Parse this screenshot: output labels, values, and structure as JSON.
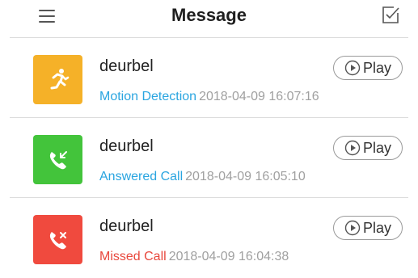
{
  "header": {
    "title": "Message",
    "menu_icon": "hamburger-menu-icon",
    "edit_icon": "select-checkbox-icon"
  },
  "messages": [
    {
      "device": "deurbel",
      "type": "Motion Detection",
      "time": "2018-04-09 16:07:16",
      "type_color": "#2aa5e0",
      "icon": "running-person-icon",
      "icon_bg": "#f5b128",
      "play_label": "Play"
    },
    {
      "device": "deurbel",
      "type": "Answered Call",
      "time": "2018-04-09 16:05:10",
      "type_color": "#2aa5e0",
      "icon": "incoming-call-icon",
      "icon_bg": "#43c43b",
      "play_label": "Play"
    },
    {
      "device": "deurbel",
      "type": "Missed Call",
      "time": "2018-04-09 16:04:38",
      "type_color": "#e8473c",
      "icon": "missed-call-icon",
      "icon_bg": "#f04a3e",
      "play_label": "Play"
    }
  ]
}
